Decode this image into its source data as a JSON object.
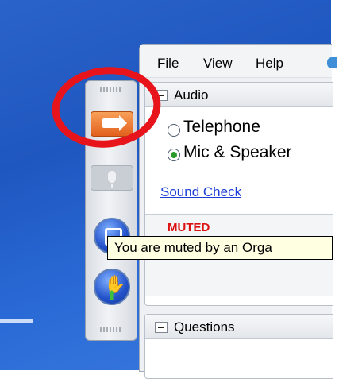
{
  "menu": {
    "file": "File",
    "view": "View",
    "help": "Help"
  },
  "audio": {
    "title": "Audio",
    "options": [
      "Telephone",
      "Mic & Speaker"
    ],
    "selected": "Mic & Speaker",
    "sound_check": "Sound Check",
    "status": "MUTED"
  },
  "tooltip": "You are muted by an Orga",
  "questions": {
    "title": "Questions"
  },
  "colors": {
    "annotation": "#e8141c",
    "accent_orange": "#e2601e",
    "link": "#1b3fd6"
  },
  "icons": [
    "grip-icon",
    "show-panel-arrow-icon",
    "microphone-icon",
    "screen-share-icon",
    "raise-hand-icon",
    "globe-icon"
  ]
}
